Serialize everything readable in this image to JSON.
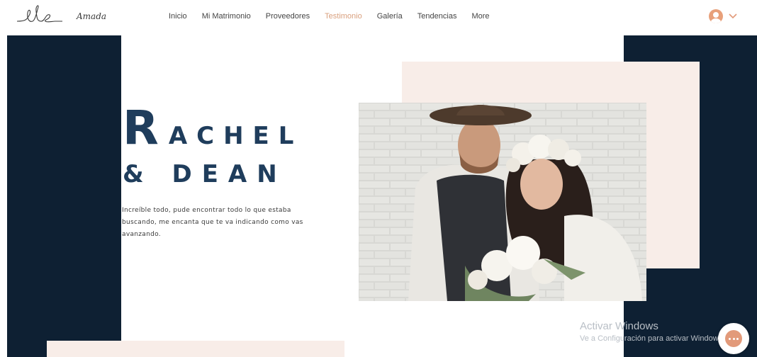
{
  "header": {
    "brand": "Amada",
    "nav": [
      {
        "label": "Inicio",
        "active": false
      },
      {
        "label": "Mi Matrimonio",
        "active": false
      },
      {
        "label": "Proveedores",
        "active": false
      },
      {
        "label": "Testimonio",
        "active": true
      },
      {
        "label": "Galería",
        "active": false
      },
      {
        "label": "Tendencias",
        "active": false
      },
      {
        "label": "More",
        "active": false
      }
    ],
    "account_icon": "user-avatar-icon"
  },
  "hero": {
    "title_initial": "R",
    "title_rest": "ACHEL",
    "title_line2": "& DEAN",
    "quote_lines": [
      "Increíble todo, pude encontrar  todo lo que estaba",
      "buscando, me encanta que te va indicando como vas",
      "avanzando."
    ]
  },
  "watermark": {
    "title": "Activar Windows",
    "subtitle": "Ve a Configuración para activar Windows."
  },
  "colors": {
    "navy": "#0e2033",
    "title_blue": "#1f3d5c",
    "blush": "#f8ede8",
    "accent": "#d9a07e"
  }
}
